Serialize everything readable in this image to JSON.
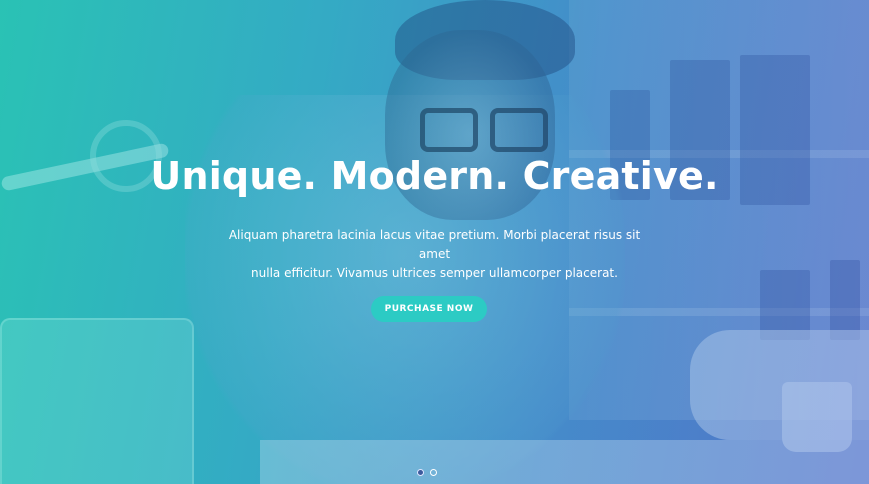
{
  "hero": {
    "headline": "Unique. Modern. Creative.",
    "subtext_line1": "Aliquam pharetra lacinia lacus vitae pretium. Morbi placerat risus sit amet",
    "subtext_line2": "nulla efficitur. Vivamus ultrices semper ullamcorper placerat.",
    "cta_label": "PURCHASE NOW",
    "slides": {
      "count": 2,
      "active_index": 0
    }
  },
  "colors": {
    "gradient_start": "#2bbfb2",
    "gradient_end": "#5b6fc6",
    "cta_background": "#2ccbc4",
    "text": "#ffffff"
  }
}
